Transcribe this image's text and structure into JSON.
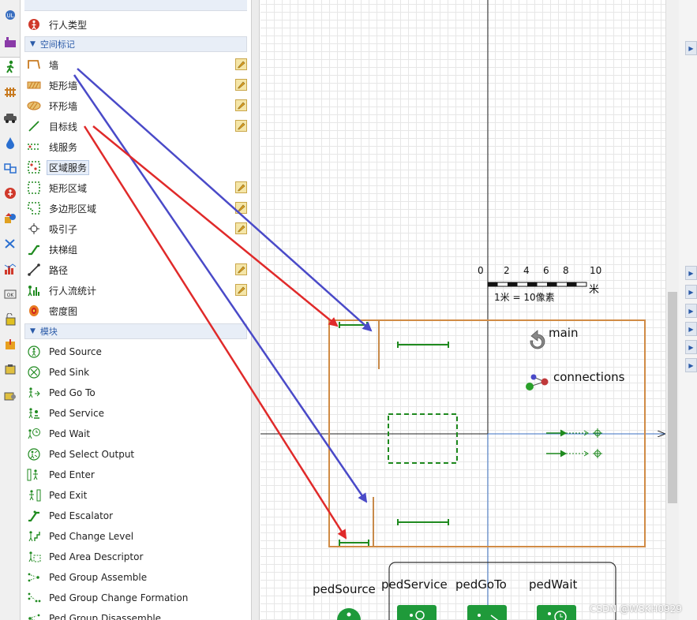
{
  "palette": {
    "top_item": "行人类型",
    "sections": [
      {
        "label": "空间标记"
      },
      {
        "label": "模块"
      }
    ],
    "space_items": [
      {
        "label": "墙",
        "icon": "wall-icon",
        "pen": true
      },
      {
        "label": "矩形墙",
        "icon": "rectangular-wall-icon",
        "pen": true
      },
      {
        "label": "环形墙",
        "icon": "circular-wall-icon",
        "pen": true
      },
      {
        "label": "目标线",
        "icon": "target-line-icon",
        "pen": true
      },
      {
        "label": "线服务",
        "icon": "line-service-icon",
        "pen": false
      },
      {
        "label": "区域服务",
        "icon": "area-service-icon",
        "pen": false,
        "selected": true
      },
      {
        "label": "矩形区域",
        "icon": "rectangular-area-icon",
        "pen": true
      },
      {
        "label": "多边形区域",
        "icon": "polygonal-area-icon",
        "pen": true
      },
      {
        "label": "吸引子",
        "icon": "attractor-icon",
        "pen": true
      },
      {
        "label": "扶梯组",
        "icon": "escalator-group-icon",
        "pen": false
      },
      {
        "label": "路径",
        "icon": "path-icon",
        "pen": true
      },
      {
        "label": "行人流统计",
        "icon": "flow-statistics-icon",
        "pen": true
      },
      {
        "label": "密度图",
        "icon": "density-map-icon",
        "pen": false
      }
    ],
    "module_items": [
      {
        "label": "Ped Source",
        "icon": "ped-source-icon"
      },
      {
        "label": "Ped Sink",
        "icon": "ped-sink-icon"
      },
      {
        "label": "Ped Go To",
        "icon": "ped-go-to-icon"
      },
      {
        "label": "Ped Service",
        "icon": "ped-service-icon"
      },
      {
        "label": "Ped Wait",
        "icon": "ped-wait-icon"
      },
      {
        "label": "Ped Select Output",
        "icon": "ped-select-output-icon"
      },
      {
        "label": "Ped Enter",
        "icon": "ped-enter-icon"
      },
      {
        "label": "Ped Exit",
        "icon": "ped-exit-icon"
      },
      {
        "label": "Ped Escalator",
        "icon": "ped-escalator-icon"
      },
      {
        "label": "Ped Change Level",
        "icon": "ped-change-level-icon"
      },
      {
        "label": "Ped Area Descriptor",
        "icon": "ped-area-descriptor-icon"
      },
      {
        "label": "Ped Group Assemble",
        "icon": "ped-group-assemble-icon"
      },
      {
        "label": "Ped Group Change Formation",
        "icon": "ped-group-change-formation-icon"
      },
      {
        "label": "Ped Group Disassemble",
        "icon": "ped-group-disassemble-icon"
      }
    ]
  },
  "canvas": {
    "scale_ticks": [
      "0",
      "2",
      "4",
      "6",
      "8",
      "10"
    ],
    "scale_unit": "米",
    "scale_caption": "1米 = 10像素",
    "main_label": "main",
    "connections_label": "connections",
    "blocks": [
      "pedSource",
      "pedService",
      "pedGoTo",
      "pedWait"
    ]
  },
  "colors": {
    "boundary": "#d08b45",
    "wall": "#c88a4a",
    "target_line": "#1f8a1f",
    "arrow_blue": "#4a4ac8",
    "arrow_red": "#e02a2a",
    "axis_blue": "#3a6fc0"
  },
  "watermark": "CSDN @WSKH0929"
}
